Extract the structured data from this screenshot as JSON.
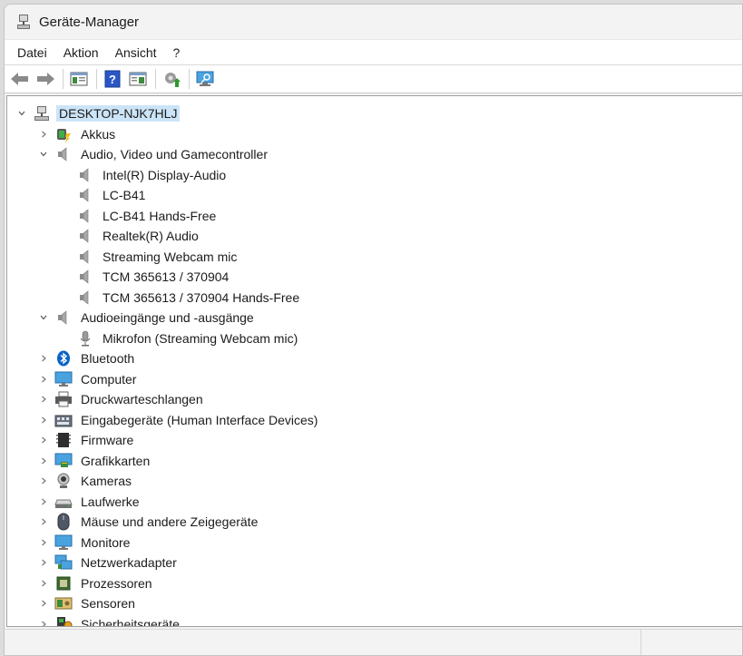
{
  "window": {
    "title": "Geräte-Manager"
  },
  "menu": [
    {
      "label": "Datei"
    },
    {
      "label": "Aktion"
    },
    {
      "label": "Ansicht"
    },
    {
      "label": "?"
    }
  ],
  "toolbar": {
    "buttons": [
      "back-icon",
      "forward-icon",
      "properties-view-icon",
      "help-icon",
      "show-hide-console-tree-icon",
      "update-driver-icon",
      "scan-hardware-icon"
    ]
  },
  "tree": {
    "root": {
      "label": "DESKTOP-NJK7HLJ",
      "expanded": true,
      "selected": true
    },
    "items": [
      {
        "label": "Akkus",
        "icon": "battery-icon",
        "expanded": false,
        "level": 1
      },
      {
        "label": "Audio, Video und Gamecontroller",
        "icon": "speaker-icon",
        "expanded": true,
        "level": 1
      },
      {
        "label": "Intel(R) Display-Audio",
        "icon": "speaker-icon",
        "level": 2
      },
      {
        "label": "LC-B41",
        "icon": "speaker-icon",
        "level": 2
      },
      {
        "label": "LC-B41 Hands-Free",
        "icon": "speaker-icon",
        "level": 2
      },
      {
        "label": "Realtek(R) Audio",
        "icon": "speaker-icon",
        "level": 2
      },
      {
        "label": "Streaming Webcam mic",
        "icon": "speaker-icon",
        "level": 2
      },
      {
        "label": "TCM 365613 / 370904",
        "icon": "speaker-icon",
        "level": 2
      },
      {
        "label": "TCM 365613 / 370904 Hands-Free",
        "icon": "speaker-icon",
        "level": 2
      },
      {
        "label": "Audioeingänge und -ausgänge",
        "icon": "speaker-icon",
        "expanded": true,
        "level": 1
      },
      {
        "label": "Mikrofon (Streaming Webcam mic)",
        "icon": "microphone-icon",
        "level": 2
      },
      {
        "label": "Bluetooth",
        "icon": "bluetooth-icon",
        "expanded": false,
        "level": 1
      },
      {
        "label": "Computer",
        "icon": "computer-icon",
        "expanded": false,
        "level": 1
      },
      {
        "label": "Druckwarteschlangen",
        "icon": "printer-icon",
        "expanded": false,
        "level": 1
      },
      {
        "label": "Eingabegeräte (Human Interface Devices)",
        "icon": "hid-icon",
        "expanded": false,
        "level": 1
      },
      {
        "label": "Firmware",
        "icon": "firmware-icon",
        "expanded": false,
        "level": 1
      },
      {
        "label": "Grafikkarten",
        "icon": "display-adapter-icon",
        "expanded": false,
        "level": 1
      },
      {
        "label": "Kameras",
        "icon": "camera-icon",
        "expanded": false,
        "level": 1
      },
      {
        "label": "Laufwerke",
        "icon": "drive-icon",
        "expanded": false,
        "level": 1
      },
      {
        "label": "Mäuse und andere Zeigegeräte",
        "icon": "mouse-icon",
        "expanded": false,
        "level": 1
      },
      {
        "label": "Monitore",
        "icon": "monitor-icon",
        "expanded": false,
        "level": 1
      },
      {
        "label": "Netzwerkadapter",
        "icon": "network-adapter-icon",
        "expanded": false,
        "level": 1
      },
      {
        "label": "Prozessoren",
        "icon": "processor-icon",
        "expanded": false,
        "level": 1
      },
      {
        "label": "Sensoren",
        "icon": "sensor-icon",
        "expanded": false,
        "level": 1
      },
      {
        "label": "Sicherheitsgeräte",
        "icon": "security-device-icon",
        "expanded": false,
        "level": 1
      }
    ]
  },
  "colors": {
    "selection": "#cce4f7",
    "accent": "#0a64c8"
  }
}
